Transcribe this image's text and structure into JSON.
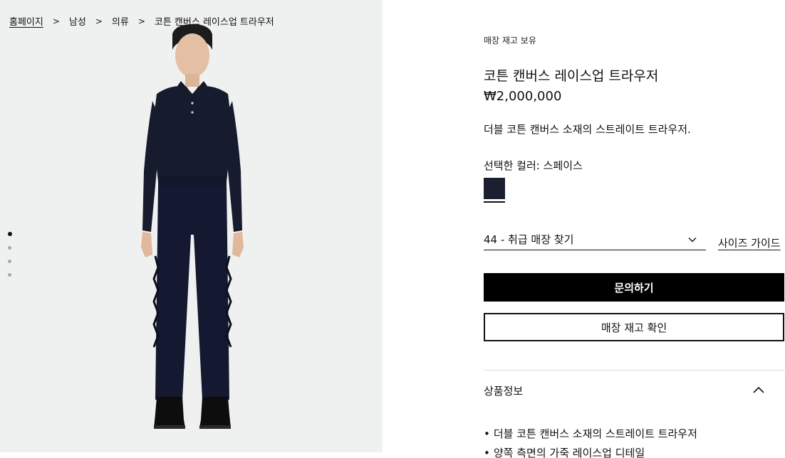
{
  "breadcrumb": {
    "items": [
      "홈페이지",
      "남성",
      "의류",
      "코튼 캔버스 레이스업 트라우저"
    ],
    "separator": ">"
  },
  "gallery": {
    "slide_count": 4,
    "active_index": 0
  },
  "product": {
    "stock_note": "매장 재고 보유",
    "title": "코튼 캔버스 레이스업 트라우저",
    "price": "₩2,000,000",
    "description": "더블 코튼 캔버스 소재의 스트레이트 트라우저.",
    "color_label": "선택한 컬러: 스페이스",
    "swatch_color": "#1b1f2f"
  },
  "size": {
    "selected": "44 - 취급 매장 찾기",
    "guide_label": "사이즈 가이드"
  },
  "actions": {
    "inquire_label": "문의하기",
    "check_stock_label": "매장 재고 확인"
  },
  "details": {
    "section_title": "상품정보",
    "expanded": true,
    "bullets": [
      "더블 코튼 캔버스 소재의 스트레이트 트라우저",
      "양쪽 측면의 가죽 레이스업 디테일"
    ]
  },
  "colors": {
    "background_panel": "#eff1f1",
    "primary_button": "#000000",
    "garment_navy": "#1b1f2f"
  }
}
